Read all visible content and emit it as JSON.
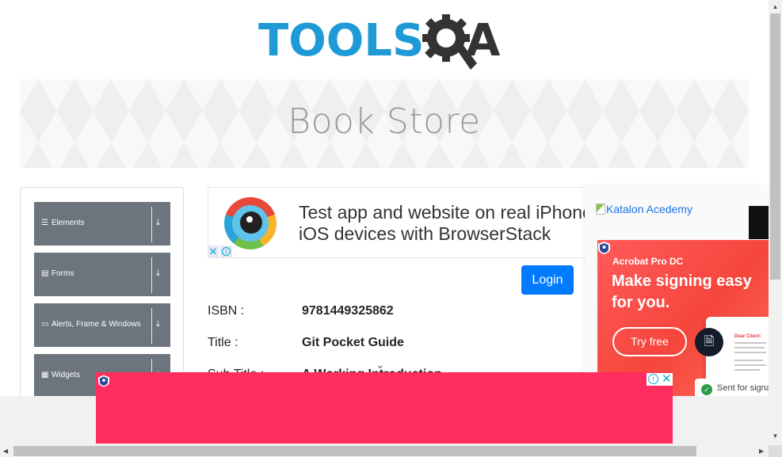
{
  "logo": {
    "part1": "TOOLS",
    "part2": "A",
    "gear_icon": "gear-magnifier-icon"
  },
  "banner": {
    "title": "Book Store"
  },
  "menu": {
    "groups": [
      {
        "label": "Elements",
        "icon": "hamburger-icon"
      },
      {
        "label": "Forms",
        "icon": "form-icon"
      },
      {
        "label": "Alerts, Frame & Windows",
        "icon": "window-icon"
      },
      {
        "label": "Widgets",
        "icon": "grid-icon"
      }
    ],
    "expand_icon": "download-arrow-icon"
  },
  "ad_top": {
    "line1": "Test app and website on real iPhone,",
    "line2": "iOS devices with BrowserStack",
    "close_label": "✕",
    "info_label": "i"
  },
  "login": {
    "label": "Login"
  },
  "book": {
    "isbn_label": "ISBN :",
    "isbn_value": "9781449325862",
    "title_label": "Title :",
    "title_value": "Git Pocket Guide",
    "subtitle_label": "Sub Title :",
    "subtitle_value": "A Working Introduction"
  },
  "right_ad": {
    "katalon_alt": "Katalon Acedemy",
    "product": "Acrobat Pro DC",
    "headline1": "Make signing easy",
    "headline2": "for you.",
    "cta": "Try free",
    "signed_text": "Sent for signature",
    "doc_header": "Dear Client:"
  },
  "bottom_ad": {
    "info_label": "i",
    "close_label": "✕",
    "color": "#ff2c5f"
  },
  "colors": {
    "brand_blue": "#1e9ad6",
    "menu_gray": "#6c757d",
    "login_blue": "#007bff",
    "adobe_red": "#f5463c"
  }
}
